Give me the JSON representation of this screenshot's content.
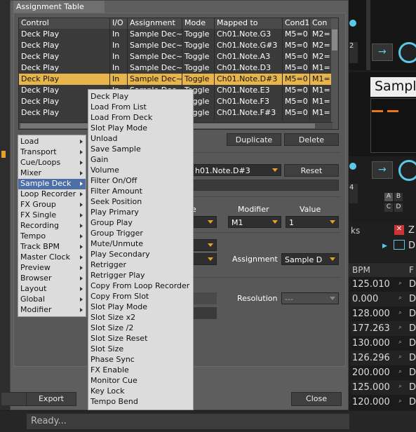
{
  "dialog": {
    "title": "Assignment Table",
    "table": {
      "columns": [
        "Control",
        "I/O",
        "Assignment",
        "Mode",
        "Mapped to",
        "Cond1",
        "Con"
      ],
      "rows": [
        [
          "Deck Play",
          "In",
          "Sample Dec~",
          "Toggle",
          "Ch01.Note.G3",
          "M5=0",
          "M2="
        ],
        [
          "Deck Play",
          "In",
          "Sample Dec~",
          "Toggle",
          "Ch01.Note.G#3",
          "M5=0",
          "M2="
        ],
        [
          "Deck Play",
          "In",
          "Sample Dec~",
          "Toggle",
          "Ch01.Note.A3",
          "M5=0",
          "M2="
        ],
        [
          "Deck Play",
          "In",
          "Sample Dec~",
          "Toggle",
          "Ch01.Note.D3",
          "M5=0",
          "M1="
        ],
        [
          "Deck Play",
          "In",
          "Sample Dec~",
          "Toggle",
          "Ch01.Note.D#3",
          "M5=0",
          "M1="
        ],
        [
          "Deck Play",
          "In",
          "Sample Dec~",
          "Toggle",
          "Ch01.Note.E3",
          "M5=0",
          "M1="
        ],
        [
          "Deck Play",
          "In",
          "Sample Dec~",
          "Toggle",
          "Ch01.Note.F3",
          "M5=0",
          "M1="
        ],
        [
          "Deck Play",
          "In",
          "Sample Dec~",
          "Toggle",
          "Ch01.Note.F#3",
          "M5=0",
          "M1="
        ]
      ],
      "selected_row": 4
    },
    "duplicate_label": "Duplicate",
    "delete_label": "Delete",
    "mapped_value": "h01.Note.D#3",
    "reset_label": "Reset",
    "modifier_header": "Modifier",
    "value_header": "Value",
    "modifier_value": "M1",
    "value_value": "1",
    "e_partial": "e",
    "assignment_label": "Assignment",
    "assignment_value": "Sample D",
    "resolution_label": "Resolution",
    "resolution_value": "---",
    "export_label": "Export",
    "import_partial": "rt",
    "close_label": "Close"
  },
  "menu_categories": [
    "Load",
    "Transport",
    "Cue/Loops",
    "Mixer",
    "Sample Deck",
    "Loop Recorder",
    "FX Group",
    "FX Single",
    "Recording",
    "Tempo",
    "Track BPM",
    "Master Clock",
    "Preview",
    "Browser",
    "Layout",
    "Global",
    "Modifier"
  ],
  "menu_highlighted": "Sample Deck",
  "submenu_items": [
    "Deck Play",
    "Load From List",
    "Load From Deck",
    "Slot Play Mode",
    "Unload",
    "Save Sample",
    "Gain",
    "Volume",
    "Filter On/Off",
    "Filter Amount",
    "Seek Position",
    "Play Primary",
    "Group Play",
    "Group Trigger",
    "Mute/Unmute",
    "Play Secondary",
    "Retrigger",
    "Retrigger Play",
    "Copy From Loop Recorder",
    "Copy From Slot",
    "Slot Play Mode",
    "Slot Size x2",
    "Slot Size /2",
    "Slot Size Reset",
    "Slot Size",
    "Phase Sync",
    "FX Enable",
    "Monitor Cue",
    "Key Lock",
    "Tempo Bend"
  ],
  "background": {
    "sample_deck_title": "Sampl",
    "bpm_header": "BPM",
    "f_header": "F",
    "bpm_values": [
      "125.010",
      "0.000",
      "128.000",
      "177.263",
      "130.000",
      "126.296",
      "200.000",
      "125.000",
      "120.000"
    ],
    "d_letter": "D",
    "ab_labels": [
      "A",
      "B",
      "C",
      "D"
    ],
    "ks_partial": "ks",
    "z_partial": "Z",
    "d_partial": "D",
    "num_2": "2",
    "num_4": "4"
  },
  "status_text": "Ready..."
}
